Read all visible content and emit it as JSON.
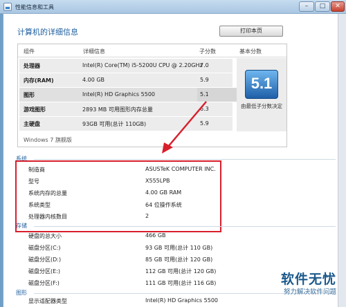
{
  "window": {
    "title": "性能信息和工具"
  },
  "header": {
    "heading": "计算机的详细信息",
    "print_button": "打印本页"
  },
  "score_panel": {
    "columns": [
      "组件",
      "详细信息",
      "子分数",
      "基本分数"
    ],
    "rows": [
      {
        "component": "处理器",
        "detail": "Intel(R) Core(TM) i5-5200U CPU @ 2.20GHz",
        "subscore": "7.0"
      },
      {
        "component": "内存(RAM)",
        "detail": "4.00 GB",
        "subscore": "5.9"
      },
      {
        "component": "图形",
        "detail": "Intel(R) HD Graphics 5500",
        "subscore": "5.1"
      },
      {
        "component": "游戏图形",
        "detail": "2893 MB 可用图形内存总量",
        "subscore": "6.3"
      },
      {
        "component": "主硬盘",
        "detail": "93GB 可用(总计 110GB)",
        "subscore": "5.9"
      }
    ],
    "base_score": "5.1",
    "base_score_desc": "由最低子分数决定",
    "edition": "Windows 7 旗舰版"
  },
  "system": {
    "title": "系统",
    "rows": [
      {
        "label": "制造商",
        "value": "ASUSTeK COMPUTER INC."
      },
      {
        "label": "型号",
        "value": "X555LPB"
      },
      {
        "label": "系统内存的总量",
        "value": "4.00 GB RAM"
      },
      {
        "label": "系统类型",
        "value": "64 位操作系统"
      },
      {
        "label": "处理器内核数目",
        "value": "2"
      }
    ]
  },
  "storage": {
    "title": "存储",
    "rows": [
      {
        "label": "硬盘的总大小",
        "value": "466 GB"
      },
      {
        "label": "磁盘分区(C:)",
        "value": "93 GB 可用(总计 110 GB)"
      },
      {
        "label": "磁盘分区(D:)",
        "value": "85 GB 可用(总计 120 GB)"
      },
      {
        "label": "磁盘分区(E:)",
        "value": "112 GB 可用(总计 120 GB)"
      },
      {
        "label": "磁盘分区(F:)",
        "value": "111 GB 可用(总计 116 GB)"
      }
    ]
  },
  "graphics": {
    "title": "图形",
    "rows": [
      {
        "label": "显示适配器类型",
        "value": "Intel(R) HD Graphics 5500"
      }
    ]
  },
  "watermark": {
    "main": "软件无忧",
    "sub": "努力解决软件问题"
  },
  "colors": {
    "heading": "#1f5fa0",
    "highlight_box": "#d81f2b",
    "badge": "#2a76c4"
  },
  "icons": [
    "app-icon",
    "minimize-icon",
    "maximize-icon",
    "close-icon",
    "score-badge-icon",
    "annotation-arrow-icon"
  ]
}
